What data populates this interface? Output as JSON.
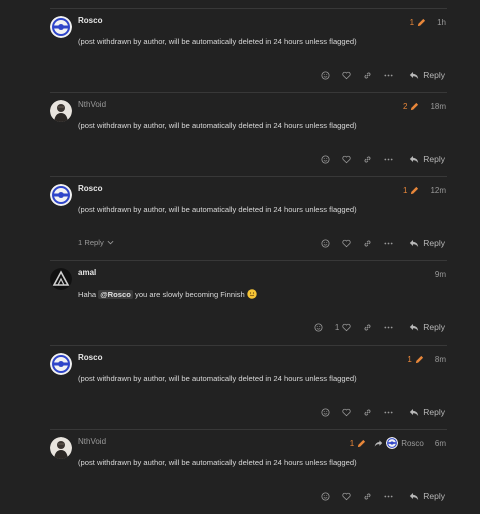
{
  "posts": [
    {
      "username": "Rosco",
      "edit_count": "1",
      "time": "1h",
      "body": "(post withdrawn by author, will be automatically deleted in 24 hours unless flagged)",
      "reply_label": "Reply"
    },
    {
      "username": "NthVoid",
      "edit_count": "2",
      "time": "18m",
      "body": "(post withdrawn by author, will be automatically deleted in 24 hours unless flagged)",
      "reply_label": "Reply"
    },
    {
      "username": "Rosco",
      "edit_count": "1",
      "time": "12m",
      "body": "(post withdrawn by author, will be automatically deleted in 24 hours unless flagged)",
      "replies_toggle": "1 Reply",
      "reply_label": "Reply"
    },
    {
      "username": "amal",
      "time": "9m",
      "body_before": "Haha",
      "mention": "@Rosco",
      "body_after": "you are slowly becoming Finnish",
      "like_count": "1",
      "reply_label": "Reply"
    },
    {
      "username": "Rosco",
      "edit_count": "1",
      "time": "8m",
      "body": "(post withdrawn by author, will be automatically deleted in 24 hours unless flagged)",
      "reply_label": "Reply"
    },
    {
      "username": "NthVoid",
      "edit_count": "1",
      "time": "6m",
      "reply_to": "Rosco",
      "body": "(post withdrawn by author, will be automatically deleted in 24 hours unless flagged)",
      "reply_label": "Reply"
    }
  ],
  "colors": {
    "background": "#222222",
    "accent_edit": "#e8873a",
    "rosco_avatar": "#2f45c9",
    "text_muted": "#9a9a9a"
  },
  "icons": [
    "emoji-reaction-icon",
    "heart-icon",
    "link-icon",
    "more-icon",
    "reply-icon",
    "pencil-icon",
    "chevron-down-icon",
    "reply-arrow-icon"
  ]
}
